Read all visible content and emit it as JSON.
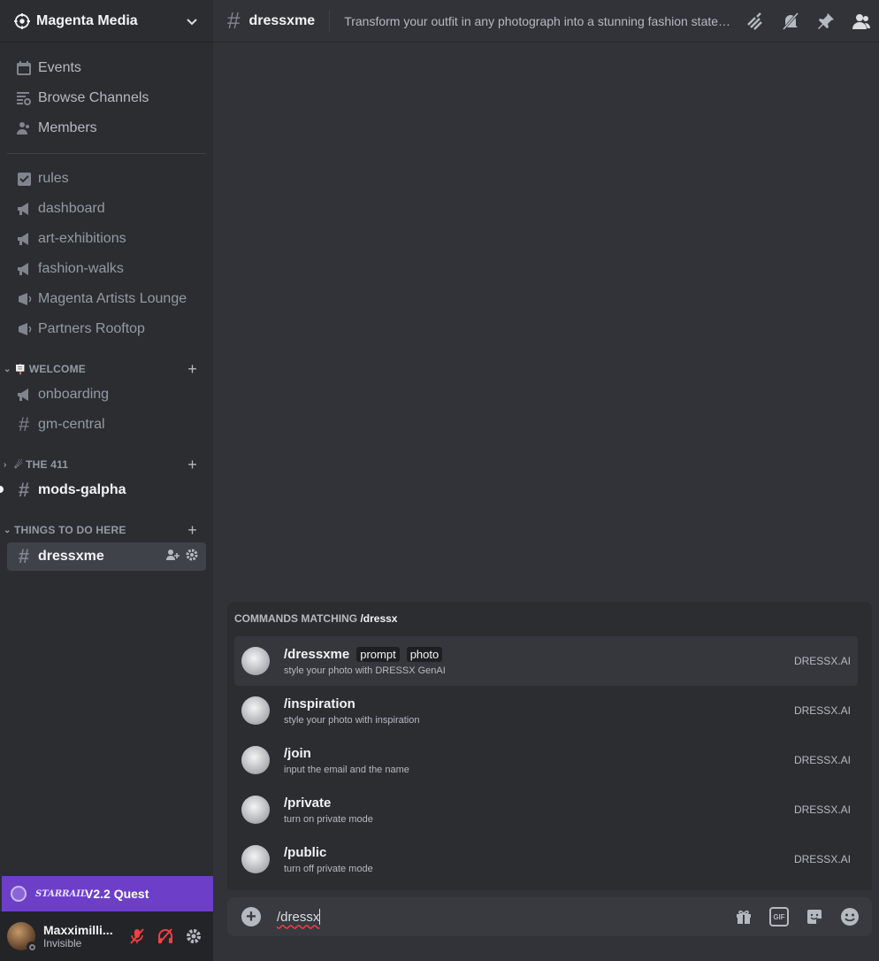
{
  "guild": {
    "name": "Magenta Media"
  },
  "nav": [
    {
      "label": "Events",
      "icon": "calendar-icon"
    },
    {
      "label": "Browse Channels",
      "icon": "browse-channels-icon"
    },
    {
      "label": "Members",
      "icon": "members-icon"
    }
  ],
  "channels_top": [
    {
      "label": "rules",
      "icon": "rules-checkbox-icon"
    },
    {
      "label": "dashboard",
      "icon": "announcement-icon"
    },
    {
      "label": "art-exhibitions",
      "icon": "announcement-icon"
    },
    {
      "label": "fashion-walks",
      "icon": "announcement-icon"
    },
    {
      "label": "Magenta Artists Lounge",
      "icon": "stage-icon"
    },
    {
      "label": "Partners Rooftop",
      "icon": "stage-icon"
    }
  ],
  "categories": {
    "welcome": {
      "label": "WELCOME",
      "emoji": "🪧"
    },
    "the411": {
      "label": "THE 411",
      "emoji": "☄"
    },
    "things": {
      "label": "THINGS TO DO HERE"
    }
  },
  "welcome_channels": [
    {
      "label": "onboarding",
      "icon": "announcement-icon"
    },
    {
      "label": "gm-central",
      "icon": "hash-icon"
    }
  ],
  "mods_channel": {
    "label": "mods-galpha"
  },
  "selected_channel": {
    "label": "dressxme"
  },
  "quest": {
    "label": "V2.2 Quest",
    "logo_text": "STARRAIL"
  },
  "user": {
    "name": "Maxximilli...",
    "status": "Invisible"
  },
  "topbar": {
    "channel": "dressxme",
    "topic": "Transform your outfit in any photograph into a stunning fashion stateme..."
  },
  "autocomplete": {
    "header_prefix": "COMMANDS MATCHING",
    "query": "/dressx",
    "commands": [
      {
        "name": "/dressxme",
        "options": [
          "prompt",
          "photo"
        ],
        "desc": "style your photo with DRESSX GenAI",
        "source": "DRESSX.AI"
      },
      {
        "name": "/inspiration",
        "options": [],
        "desc": "style your photo with inspiration",
        "source": "DRESSX.AI"
      },
      {
        "name": "/join",
        "options": [],
        "desc": "input the email and the name",
        "source": "DRESSX.AI"
      },
      {
        "name": "/private",
        "options": [],
        "desc": "turn on private mode",
        "source": "DRESSX.AI"
      },
      {
        "name": "/public",
        "options": [],
        "desc": "turn off private mode",
        "source": "DRESSX.AI"
      }
    ]
  },
  "composer": {
    "value": "/dressx"
  }
}
